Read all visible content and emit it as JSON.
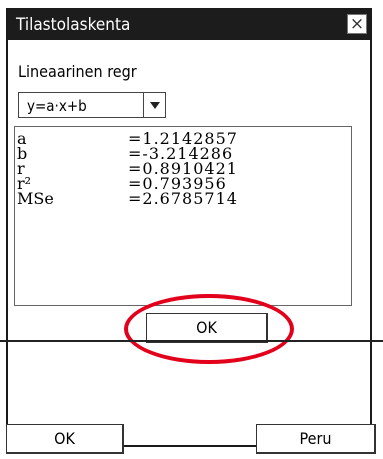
{
  "dialog": {
    "title": "Tilastolaskenta",
    "close_label": "×",
    "regression_label": "Lineaarinen regr",
    "model": {
      "selected": "y=a·x+b",
      "arrow": "chevron-down-icon"
    },
    "results": [
      {
        "name": "a",
        "value": "=1.2142857"
      },
      {
        "name": "b",
        "value": "=-3.214286"
      },
      {
        "name": "r",
        "value": "=0.8910421"
      },
      {
        "name": "r²",
        "value": "=0.793956"
      },
      {
        "name": "MSe",
        "value": "=2.6785714"
      }
    ],
    "ok_label": "OK"
  },
  "bottom": {
    "ok_label": "OK",
    "cancel_label": "Peru"
  },
  "colors": {
    "titlebar": "#1c1c1c",
    "highlight": "#e3001b"
  }
}
